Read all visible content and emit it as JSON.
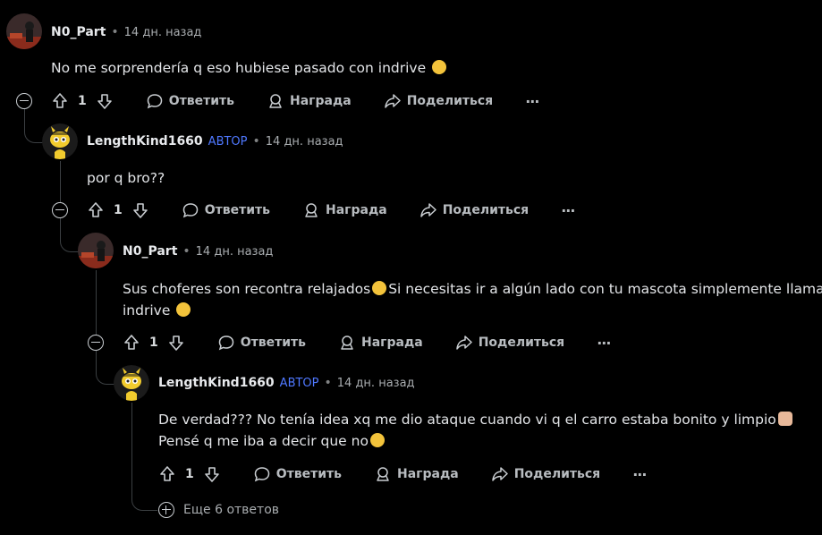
{
  "comments": [
    {
      "author": "N0_Part",
      "op_badge": "",
      "time": "14 дн. назад",
      "text_lines": [
        "No me sorprendería q eso hubiese pasado con indrive"
      ],
      "votes": "1"
    },
    {
      "author": "LengthKind1660",
      "op_badge": "АВТОР",
      "time": "14 дн. назад",
      "text_lines": [
        "por q bro??"
      ],
      "votes": "1"
    },
    {
      "author": "N0_Part",
      "op_badge": "",
      "time": "14 дн. назад",
      "text_lines": [
        "Sus choferes son recontra relajados",
        "Si necesitas ir a algún lado con tu mascota simplemente llama",
        "indrive"
      ],
      "votes": "1"
    },
    {
      "author": "LengthKind1660",
      "op_badge": "АВТОР",
      "time": "14 дн. назад",
      "text_lines": [
        "De verdad??? No tenía idea xq me dio ataque cuando vi q el carro estaba bonito y limpio",
        "Pensé q me iba a decir que no"
      ],
      "votes": "1"
    }
  ],
  "actions": {
    "reply": "Ответить",
    "award": "Награда",
    "share": "Поделиться",
    "more": "···"
  },
  "more_replies": "Еще 6 ответов",
  "colors": {
    "background": "#000000",
    "op_badge": "#4f78ff",
    "thread_line": "#3b3f42"
  },
  "icons": [
    "upvote-icon",
    "downvote-icon",
    "comment-icon",
    "award-icon",
    "share-icon",
    "overflow-icon",
    "collapse-icon",
    "expand-icon"
  ]
}
